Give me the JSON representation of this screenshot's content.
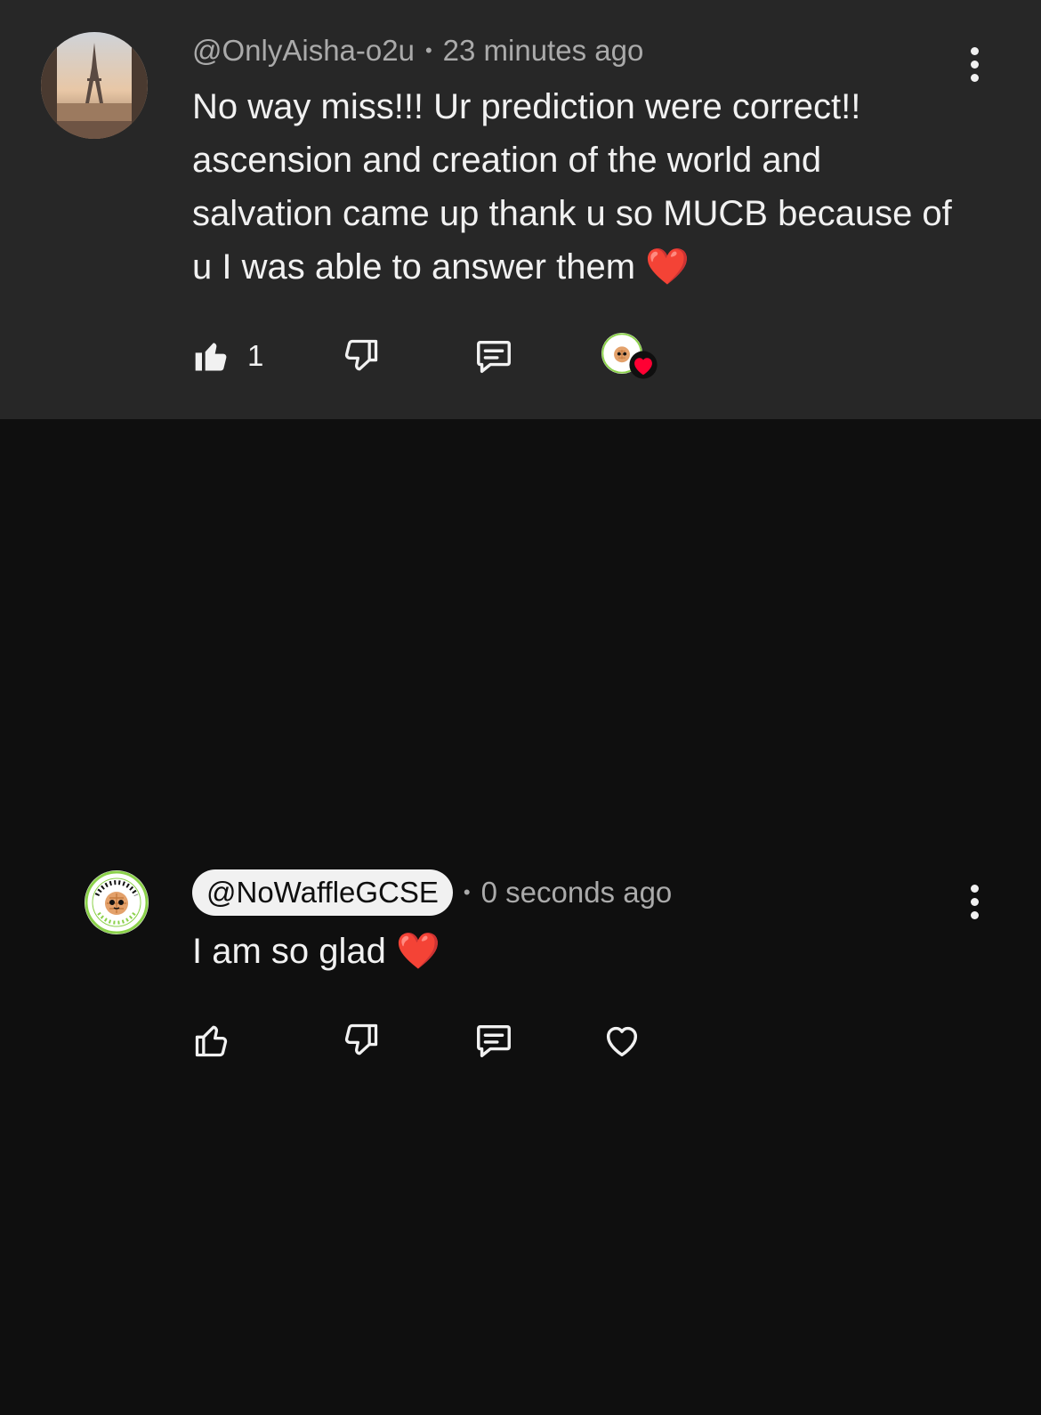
{
  "comment": {
    "handle": "@OnlyAisha-o2u",
    "separator": "•",
    "time": "23 minutes ago",
    "text": "No way miss!!! Ur prediction were correct!! ascension and creation of the world and salvation came up thank u so MUCB because of u I was able to answer them ❤️",
    "like_count": "1",
    "liked": true,
    "creator_hearted": true
  },
  "reply": {
    "handle": "@NoWaffleGCSE",
    "separator": "•",
    "time": "0 seconds ago",
    "text": "I am so glad ❤️",
    "liked": false
  },
  "colors": {
    "top_background": "#272727",
    "page_background": "#0f0f0f",
    "meta_text": "#aaaaaa",
    "heart_red": "#ff0033",
    "logo_green": "#8bd14a"
  },
  "icons": {
    "like": "thumbs-up-icon",
    "dislike": "thumbs-down-icon",
    "reply": "comment-icon",
    "heart": "heart-icon",
    "more": "more-vert-icon"
  },
  "logo": {
    "text_top": "NO WAFFLE GCSE",
    "text_bottom": "NO WAFFLE A1"
  }
}
